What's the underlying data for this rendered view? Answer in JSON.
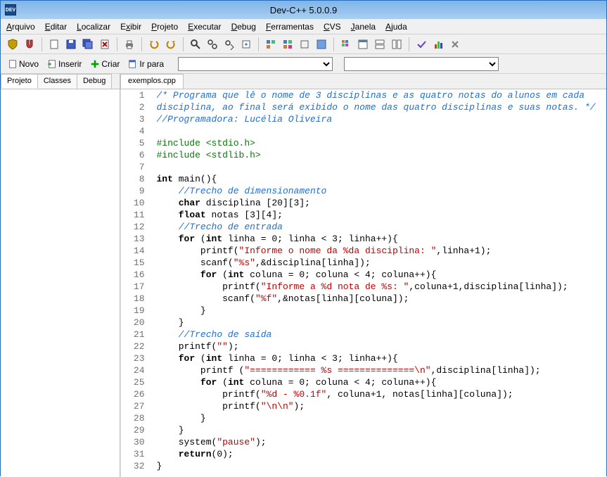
{
  "window": {
    "title": "Dev-C++ 5.0.0.9",
    "icon_text": "DEV"
  },
  "menus": {
    "arquivo": "Arquivo",
    "editar": "Editar",
    "localizar": "Localizar",
    "exibir": "Exibir",
    "projeto": "Projeto",
    "executar": "Executar",
    "debug": "Debug",
    "ferramentas": "Ferramentas",
    "cvs": "CVS",
    "janela": "Janela",
    "ajuda": "Ajuda"
  },
  "toolbar2": {
    "novo": "Novo",
    "inserir": "Inserir",
    "criar": "Criar",
    "ir_para": "Ir para",
    "combo1": "",
    "combo2": ""
  },
  "left_tabs": {
    "projeto": "Projeto",
    "classes": "Classes",
    "debug": "Debug"
  },
  "file_tabs": {
    "current": "exemplos.cpp"
  },
  "code": [
    {
      "n": 1,
      "html": "<span class='c-comment'>/* Programa que lê o nome de 3 disciplinas e as quatro notas do alunos em cada</span>"
    },
    {
      "n": 2,
      "html": "<span class='c-comment'>disciplina, ao final será exibido o nome das quatro disciplinas e suas notas. */</span>"
    },
    {
      "n": 3,
      "html": "<span class='c-comment'>//Programadora: Lucélia Oliveira</span>"
    },
    {
      "n": 4,
      "html": ""
    },
    {
      "n": 5,
      "html": "<span class='c-pre'>#include &lt;stdio.h&gt;</span>"
    },
    {
      "n": 6,
      "html": "<span class='c-pre'>#include &lt;stdlib.h&gt;</span>"
    },
    {
      "n": 7,
      "html": ""
    },
    {
      "n": 8,
      "html": "<span class='c-kw'>int</span> main(){"
    },
    {
      "n": 9,
      "html": "    <span class='c-comment'>//Trecho de dimensionamento</span>"
    },
    {
      "n": 10,
      "html": "    <span class='c-kw'>char</span> disciplina [20][3];"
    },
    {
      "n": 11,
      "html": "    <span class='c-kw'>float</span> notas [3][4];"
    },
    {
      "n": 12,
      "html": "    <span class='c-comment'>//Trecho de entrada</span>"
    },
    {
      "n": 13,
      "html": "    <span class='c-kw'>for</span> (<span class='c-kw'>int</span> linha = 0; linha &lt; 3; linha++){"
    },
    {
      "n": 14,
      "html": "        printf(<span class='c-str'>\"Informe o nome da %da disciplina: \"</span>,linha+1);"
    },
    {
      "n": 15,
      "html": "        scanf(<span class='c-str'>\"%s\"</span>,&amp;disciplina[linha]);"
    },
    {
      "n": 16,
      "html": "        <span class='c-kw'>for</span> (<span class='c-kw'>int</span> coluna = 0; coluna &lt; 4; coluna++){"
    },
    {
      "n": 17,
      "html": "            printf(<span class='c-str'>\"Informe a %d nota de %s: \"</span>,coluna+1,disciplina[linha]);"
    },
    {
      "n": 18,
      "html": "            scanf(<span class='c-str'>\"%f\"</span>,&amp;notas[linha][coluna]);"
    },
    {
      "n": 19,
      "html": "        }"
    },
    {
      "n": 20,
      "html": "    }"
    },
    {
      "n": 21,
      "html": "    <span class='c-comment'>//Trecho de saída</span>"
    },
    {
      "n": 22,
      "html": "    printf(<span class='c-str'>\"\"</span>);"
    },
    {
      "n": 23,
      "html": "    <span class='c-kw'>for</span> (<span class='c-kw'>int</span> linha = 0; linha &lt; 3; linha++){"
    },
    {
      "n": 24,
      "html": "        printf (<span class='c-str'>\"============ %s ==============\\n\"</span>,disciplina[linha]);"
    },
    {
      "n": 25,
      "html": "        <span class='c-kw'>for</span> (<span class='c-kw'>int</span> coluna = 0; coluna &lt; 4; coluna++){"
    },
    {
      "n": 26,
      "html": "            printf(<span class='c-str'>\"%d - %0.1f\"</span>, coluna+1, notas[linha][coluna]);"
    },
    {
      "n": 27,
      "html": "            printf(<span class='c-str'>\"\\n\\n\"</span>);"
    },
    {
      "n": 28,
      "html": "        }"
    },
    {
      "n": 29,
      "html": "    }"
    },
    {
      "n": 30,
      "html": "    system(<span class='c-str'>\"pause\"</span>);"
    },
    {
      "n": 31,
      "html": "    <span class='c-kw'>return</span>(0);"
    },
    {
      "n": 32,
      "html": "}"
    }
  ]
}
